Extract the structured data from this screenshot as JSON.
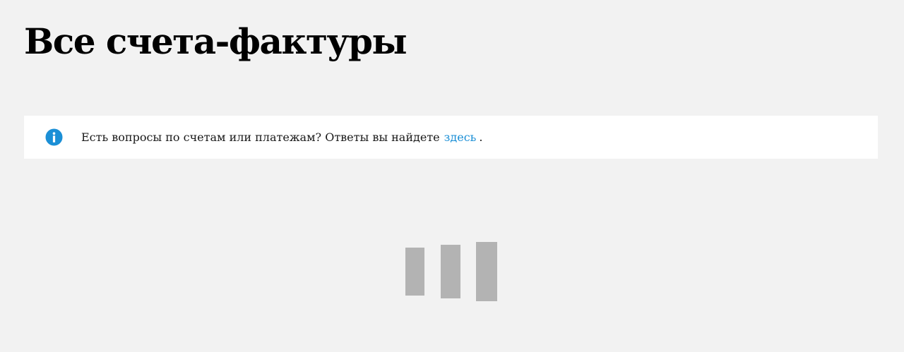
{
  "page": {
    "title": "Все счета-фактуры"
  },
  "info_banner": {
    "icon": "info-icon",
    "icon_color": "#1b8fd6",
    "text": "Есть вопросы по счетам или платежам? Ответы вы найдете",
    "link_label": "здесь",
    "trailing": "."
  },
  "loader": {
    "icon": "loading-bars-icon",
    "color": "#b3b3b3"
  }
}
